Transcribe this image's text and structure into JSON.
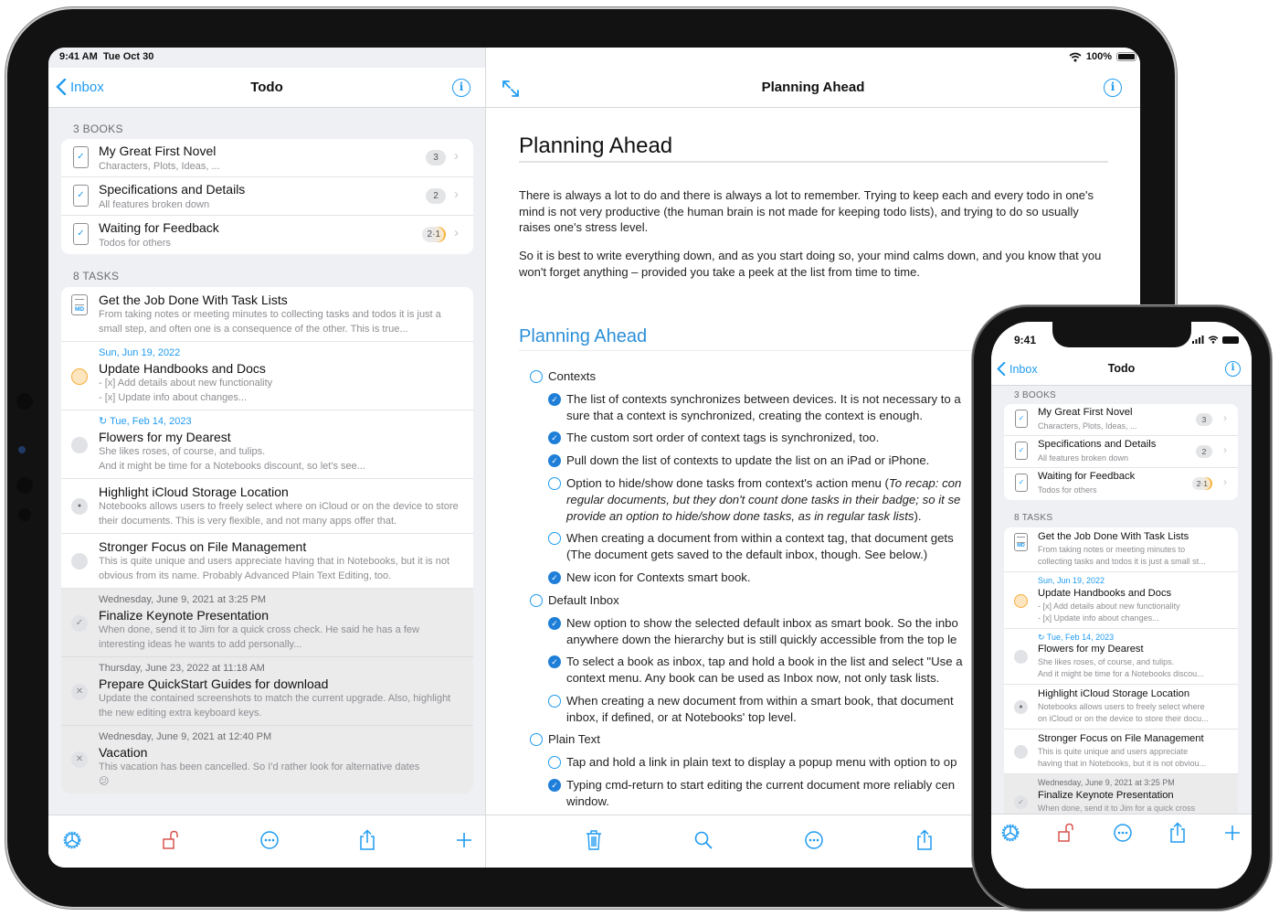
{
  "ipad": {
    "status_time": "9:41 AM",
    "status_date": "Tue Oct 30",
    "battery_text": "100%",
    "left": {
      "back_label": "Inbox",
      "title": "Todo",
      "books_header": "3 BOOKS",
      "books": [
        {
          "title": "My Great First Novel",
          "subtitle": "Characters, Plots, Ideas, ...",
          "badge": "3"
        },
        {
          "title": "Specifications and Details",
          "subtitle": "All features broken down",
          "badge": "2"
        },
        {
          "title": "Waiting for Feedback",
          "subtitle": "Todos for others",
          "badge": "2·1"
        }
      ],
      "tasks_header": "8 TASKS",
      "tasks": [
        {
          "type": "markdown",
          "icon_label": "MD",
          "date": "",
          "title": "Get the Job Done With Task Lists",
          "desc": "From taking notes or meeting minutes to collecting tasks and todos it is just a small step, and often one is a consequence of the other. This is true..."
        },
        {
          "type": "due",
          "date": "Sun, Jun 19, 2022",
          "title": "Update Handbooks and Docs",
          "desc": "- [x] Add details about new functionality\n- [x] Update info about changes..."
        },
        {
          "type": "open",
          "date": "↻ Tue, Feb 14, 2023",
          "title": "Flowers for my Dearest",
          "desc": "She likes roses, of course, and tulips.\nAnd it might be time for a Notebooks discount, so let's see..."
        },
        {
          "type": "in-progress",
          "date": "",
          "title": "Highlight iCloud Storage Location",
          "desc": "Notebooks allows users to freely select where on iCloud or on the device to store their documents. This is very flexible, and not many apps offer that."
        },
        {
          "type": "open",
          "date": "",
          "title": "Stronger Focus on File Management",
          "desc": "This is quite unique and users appreciate having that in Notebooks, but it is not obvious from its name. Probably Advanced Plain Text Editing, too."
        },
        {
          "type": "done",
          "date": "Wednesday, June 9, 2021 at 3:25 PM",
          "title": "Finalize Keynote Presentation",
          "desc": "When done, send it to Jim for a quick cross check. He said he has a few interesting ideas he wants to add personally..."
        },
        {
          "type": "cancelled",
          "date": "Thursday, June 23, 2022 at 11:18 AM",
          "title": "Prepare QuickStart Guides for download",
          "desc": "Update the contained screenshots to match the current upgrade. Also, highlight the new editing extra keyboard keys."
        },
        {
          "type": "cancelled",
          "date": "Wednesday, June 9, 2021 at 12:40 PM",
          "title": "Vacation",
          "desc": "This vacation has been cancelled. So I'd rather look for alternative dates\n😕"
        }
      ],
      "toolbar": [
        "settings-gear-icon",
        "unlock-icon",
        "more-icon",
        "share-icon",
        "add-icon"
      ]
    },
    "right": {
      "title": "Planning Ahead",
      "doc": {
        "h1": "Planning Ahead",
        "paragraphs": [
          "There is always a lot to do and there is always a lot to remember. Trying to keep each and every todo in one's mind is not very productive (the human brain is not made for keeping todo lists), and trying to do so usually raises one's stress level.",
          "So it is best to write everything down, and as you start doing so, your mind calms down, and you know that you won't forget anything – provided you take a peek at the list from time to time."
        ],
        "h2": "Planning Ahead",
        "todos": [
          {
            "level": 0,
            "checked": false,
            "lines": [
              "Contexts"
            ]
          },
          {
            "level": 1,
            "checked": true,
            "lines": [
              "The list of contexts synchronizes between devices. It is not necessary to a",
              "sure that a context is synchronized, creating the context is enough."
            ]
          },
          {
            "level": 1,
            "checked": true,
            "lines": [
              "The custom sort order of context tags is synchronized, too."
            ]
          },
          {
            "level": 1,
            "checked": true,
            "lines": [
              "Pull down the list of contexts to update the list on an iPad or iPhone."
            ]
          },
          {
            "level": 1,
            "checked": false,
            "lines": [
              "Option to hide/show done tasks from context's action menu (",
              "regular documents, but they don't count done tasks in their badge; so it se",
              "provide an option to hide/show done tasks, as in regular task lists",
              ")."
            ],
            "italic_note": "To recap: con"
          },
          {
            "level": 1,
            "checked": false,
            "lines": [
              "When creating a document from within a context tag, that document gets",
              "(The document gets saved to the default inbox, though. See below.)"
            ]
          },
          {
            "level": 1,
            "checked": true,
            "lines": [
              "New icon for Contexts smart book."
            ]
          },
          {
            "level": 0,
            "checked": false,
            "lines": [
              "Default Inbox"
            ]
          },
          {
            "level": 1,
            "checked": true,
            "lines": [
              "New option to show the selected default inbox as smart book. So the inbo",
              "anywhere down the hierarchy but is still quickly accessible from the top le"
            ]
          },
          {
            "level": 1,
            "checked": true,
            "lines": [
              "To select a book as inbox, tap and hold a book in the list and select \"Use a",
              "context menu. Any book can be used as Inbox now, not only task lists."
            ]
          },
          {
            "level": 1,
            "checked": false,
            "lines": [
              "When creating a new document from within a smart book, that document",
              "inbox, if defined, or at Notebooks' top level."
            ]
          },
          {
            "level": 0,
            "checked": false,
            "lines": [
              "Plain Text"
            ]
          },
          {
            "level": 1,
            "checked": false,
            "lines": [
              "Tap and hold a link in plain text to display a popup menu with option to op"
            ]
          },
          {
            "level": 1,
            "checked": true,
            "lines": [
              "Typing cmd-return to start editing the current document more reliably cen",
              "window."
            ]
          }
        ]
      },
      "toolbar": [
        "trash-icon",
        "search-icon",
        "more-icon",
        "share-icon"
      ]
    }
  },
  "iphone": {
    "status_time": "9:41",
    "back_label": "Inbox",
    "title": "Todo",
    "books_header": "3 BOOKS",
    "books": [
      {
        "title": "My Great First Novel",
        "subtitle": "Characters, Plots, Ideas, ...",
        "badge": "3"
      },
      {
        "title": "Specifications and Details",
        "subtitle": "All features broken down",
        "badge": "2"
      },
      {
        "title": "Waiting for Feedback",
        "subtitle": "Todos for others",
        "badge": "2·1"
      }
    ],
    "tasks_header": "8 TASKS",
    "tasks": [
      {
        "type": "markdown",
        "icon_label": "MD",
        "date": "",
        "title": "Get the Job Done With Task Lists",
        "desc": "From taking notes or meeting minutes to\ncollecting tasks and todos it is just a small st..."
      },
      {
        "type": "due",
        "date": "Sun, Jun 19, 2022",
        "title": "Update Handbooks and Docs",
        "desc": "- [x] Add details about new functionality\n- [x] Update info about changes..."
      },
      {
        "type": "open",
        "date": "↻ Tue, Feb 14, 2023",
        "title": "Flowers for my Dearest",
        "desc": "She likes roses, of course, and tulips.\nAnd it might be time for a Notebooks discou..."
      },
      {
        "type": "in-progress",
        "date": "",
        "title": "Highlight iCloud Storage Location",
        "desc": "Notebooks allows users to freely select where\non iCloud or on the device to store their docu..."
      },
      {
        "type": "open",
        "date": "",
        "title": "Stronger Focus on File Management",
        "desc": "This is quite unique and users appreciate\nhaving that in Notebooks, but it is not obviou..."
      },
      {
        "type": "done",
        "date": "Wednesday, June 9, 2021 at 3:25 PM",
        "title": "Finalize Keynote Presentation",
        "desc": "When done, send it to Jim for a quick cross\ncheck. He said he has a few interesting idea..."
      }
    ],
    "toolbar": [
      "settings-gear-icon",
      "unlock-icon",
      "more-icon",
      "share-icon",
      "add-icon"
    ]
  },
  "colors": {
    "accent": "#1f9bf0",
    "heading_blue": "#2b8fd8",
    "lock_red": "#d9534f",
    "due_orange": "#f5ad3b"
  }
}
